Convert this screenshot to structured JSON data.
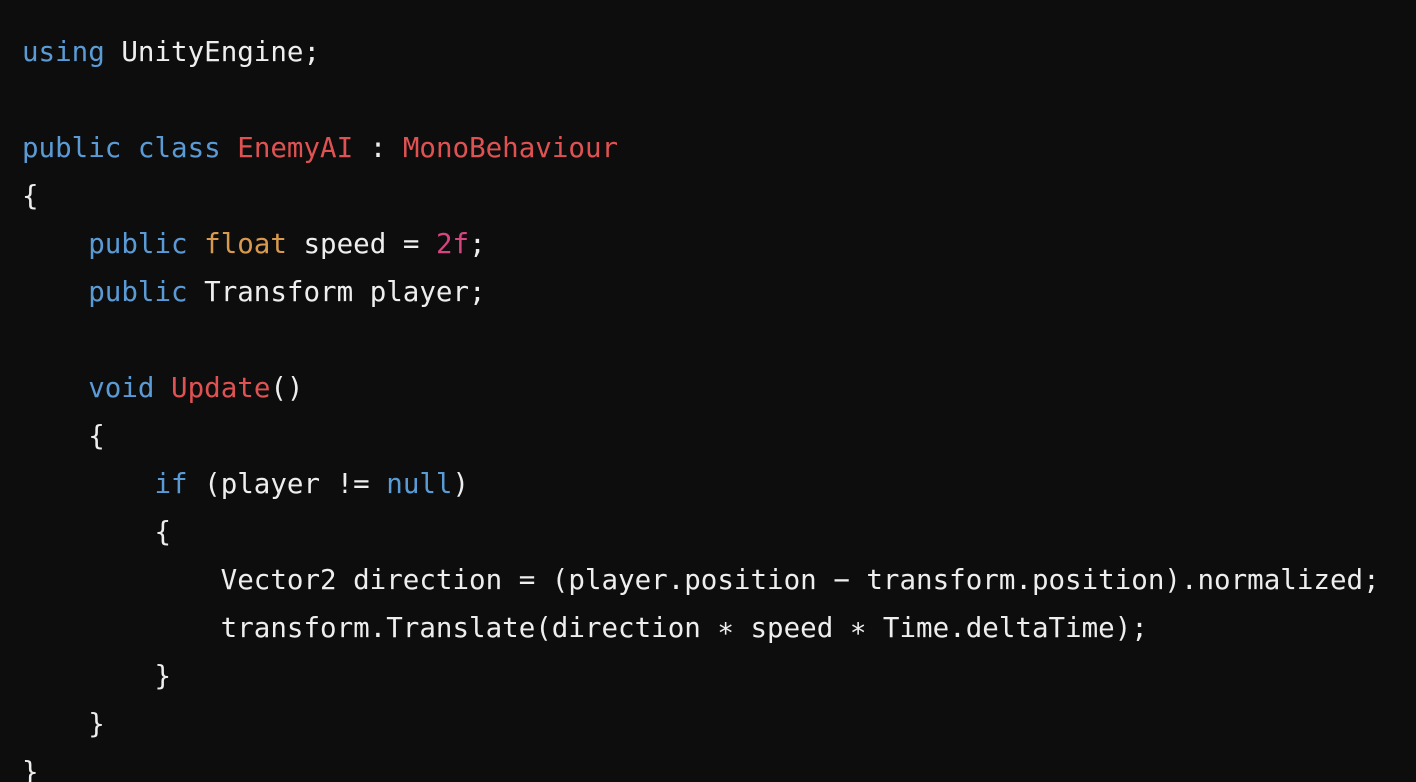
{
  "colors": {
    "background": "#0d0d0e",
    "keyword": "#5a9bd6",
    "type": "#d89a4e",
    "class_name": "#e05252",
    "number": "#d6457f",
    "plain": "#eeeeee"
  },
  "lines": [
    [
      {
        "t": "keyword",
        "s": "using"
      },
      {
        "t": "plain",
        "s": " UnityEngine;"
      }
    ],
    [],
    [
      {
        "t": "keyword",
        "s": "public"
      },
      {
        "t": "plain",
        "s": " "
      },
      {
        "t": "keyword",
        "s": "class"
      },
      {
        "t": "plain",
        "s": " "
      },
      {
        "t": "class",
        "s": "EnemyAI"
      },
      {
        "t": "plain",
        "s": " : "
      },
      {
        "t": "class",
        "s": "MonoBehaviour"
      }
    ],
    [
      {
        "t": "plain",
        "s": "{"
      }
    ],
    [
      {
        "t": "plain",
        "s": "    "
      },
      {
        "t": "keyword",
        "s": "public"
      },
      {
        "t": "plain",
        "s": " "
      },
      {
        "t": "type",
        "s": "float"
      },
      {
        "t": "plain",
        "s": " speed = "
      },
      {
        "t": "number",
        "s": "2f"
      },
      {
        "t": "plain",
        "s": ";"
      }
    ],
    [
      {
        "t": "plain",
        "s": "    "
      },
      {
        "t": "keyword",
        "s": "public"
      },
      {
        "t": "plain",
        "s": " Transform player;"
      }
    ],
    [],
    [
      {
        "t": "plain",
        "s": "    "
      },
      {
        "t": "keyword",
        "s": "void"
      },
      {
        "t": "plain",
        "s": " "
      },
      {
        "t": "class",
        "s": "Update"
      },
      {
        "t": "plain",
        "s": "()"
      }
    ],
    [
      {
        "t": "plain",
        "s": "    {"
      }
    ],
    [
      {
        "t": "plain",
        "s": "        "
      },
      {
        "t": "keyword",
        "s": "if"
      },
      {
        "t": "plain",
        "s": " (player != "
      },
      {
        "t": "keyword",
        "s": "null"
      },
      {
        "t": "plain",
        "s": ")"
      }
    ],
    [
      {
        "t": "plain",
        "s": "        {"
      }
    ],
    [
      {
        "t": "plain",
        "s": "            Vector2 direction = (player.position − transform.position).normalized;"
      }
    ],
    [
      {
        "t": "plain",
        "s": "            transform.Translate(direction ∗ speed ∗ Time.deltaTime);"
      }
    ],
    [
      {
        "t": "plain",
        "s": "        }"
      }
    ],
    [
      {
        "t": "plain",
        "s": "    }"
      }
    ],
    [
      {
        "t": "plain",
        "s": "}"
      }
    ]
  ]
}
